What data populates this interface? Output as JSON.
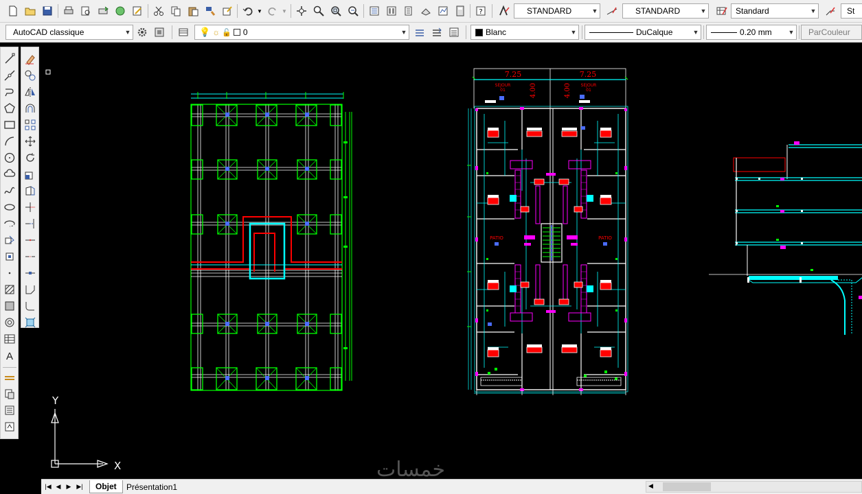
{
  "toolbar1": {
    "text_style": "STANDARD",
    "dim_style": "STANDARD",
    "table_style": "Standard",
    "multileader_style": "St"
  },
  "toolbar2": {
    "workspace": "AutoCAD classique",
    "layer": "0",
    "color": "Blanc",
    "linetype": "DuCalque",
    "lineweight": "0.20 mm",
    "plotstyle": "ParCouleur"
  },
  "drawing": {
    "dim_left": "7.25",
    "dim_right": "7.25",
    "dim_vertical_left": "4.00",
    "dim_vertical_right": "4.00",
    "room_label_left": "PATIO",
    "room_label_right": "PATIO",
    "title_left_line1": "SEJOUR",
    "title_left_line2": "01",
    "title_right_line1": "SEJOUR",
    "title_right_line2": "01"
  },
  "ucs": {
    "x_label": "X",
    "y_label": "Y"
  },
  "tabs": {
    "model": "Objet",
    "layout": "Présentation1"
  },
  "watermark": "خمسات",
  "colors": {
    "canvas": "#000000",
    "green": "#00ff00",
    "cyan": "#00ffff",
    "red": "#ff0000",
    "magenta": "#ff00ff",
    "white": "#ffffff",
    "blue": "#0000ff"
  }
}
